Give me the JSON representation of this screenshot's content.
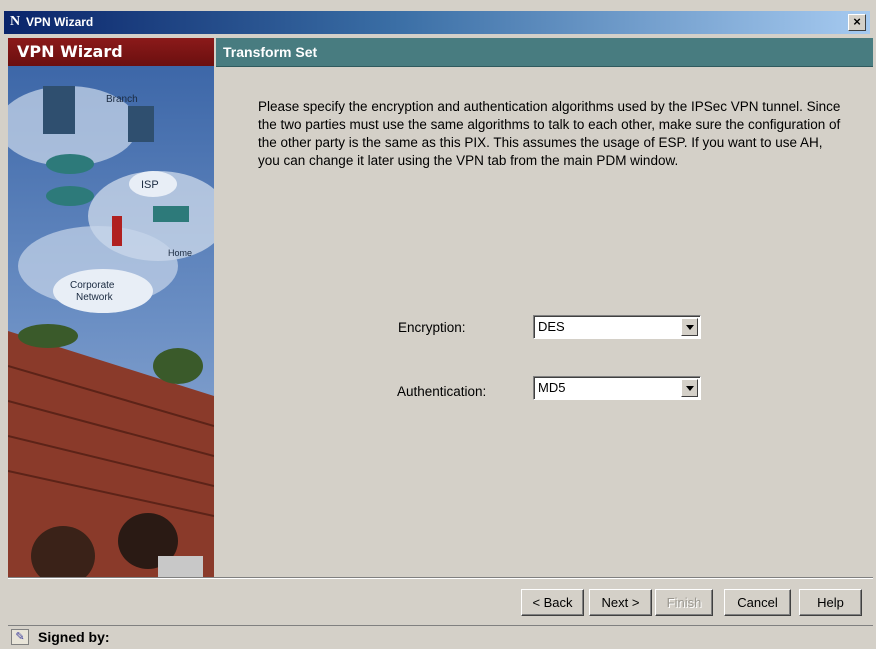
{
  "window": {
    "title": "VPN Wizard",
    "close_glyph": "×",
    "app_icon": "N"
  },
  "left_panel": {
    "header": "VPN Wizard",
    "art_labels": {
      "branch": "Branch",
      "isp": "ISP",
      "home": "Home",
      "corporate_line1": "Corporate",
      "corporate_line2": "Network"
    }
  },
  "step": {
    "title": "Transform Set"
  },
  "description": "Please specify the encryption and authentication algorithms used by the IPSec VPN tunnel.  Since the two parties must use the same algorithms to talk to each other, make sure the configuration of the other party is the same as this PIX. This assumes the usage of ESP.  If you want to use AH, you can change it later using the VPN tab from the main PDM window.",
  "form": {
    "encryption": {
      "label": "Encryption:",
      "value": "DES"
    },
    "authentication": {
      "label": "Authentication:",
      "value": "MD5"
    }
  },
  "buttons": {
    "back": "< Back",
    "next": "Next >",
    "finish": "Finish",
    "cancel": "Cancel",
    "help": "Help"
  },
  "status": {
    "signed_by": "Signed by:",
    "icon": "certificate-icon"
  },
  "colors": {
    "title_bar": "#0a246a",
    "left_header": "#8b1a1a",
    "step_header": "#487c80",
    "dialog_bg": "#d4d0c8"
  }
}
